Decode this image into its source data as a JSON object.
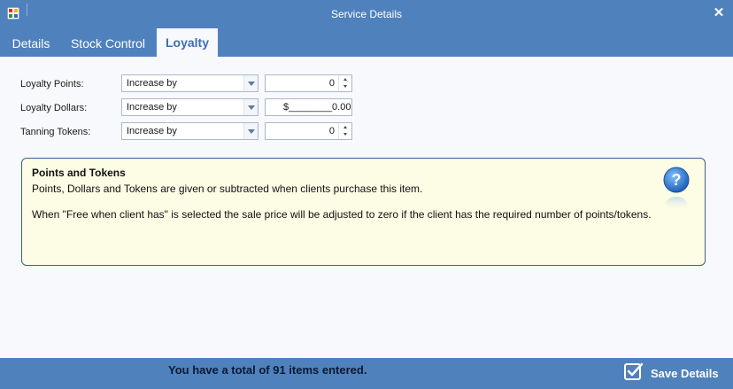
{
  "window": {
    "title": "Service Details",
    "close_glyph": "✕"
  },
  "tabs": [
    {
      "label": "Details",
      "active": false
    },
    {
      "label": "Stock Control",
      "active": false
    },
    {
      "label": "Loyalty",
      "active": true
    }
  ],
  "loyalty": {
    "rows": [
      {
        "label": "Loyalty Points:",
        "mode": "Increase by",
        "value": "0"
      },
      {
        "label": "Loyalty Dollars:",
        "mode": "Increase by",
        "value": "$________0.00"
      },
      {
        "label": "Tanning Tokens:",
        "mode": "Increase by",
        "value": "0"
      }
    ]
  },
  "info": {
    "title": "Points and Tokens",
    "line1": "Points, Dollars and Tokens are given or subtracted when clients purchase this item.",
    "line2": "When \"Free when client has\" is selected the sale price will be adjusted to zero if the client has the required number of points/tokens.",
    "icon": "help-icon"
  },
  "status": {
    "text": "You have a total of 91 items entered."
  },
  "actions": {
    "save_label": "Save Details",
    "save_icon": "checkmark-icon"
  },
  "colors": {
    "chrome": "#4f81bd",
    "panel": "#f7f9fc",
    "info_bg": "#fdfce4",
    "active_tab_text": "#3c6eb5"
  }
}
